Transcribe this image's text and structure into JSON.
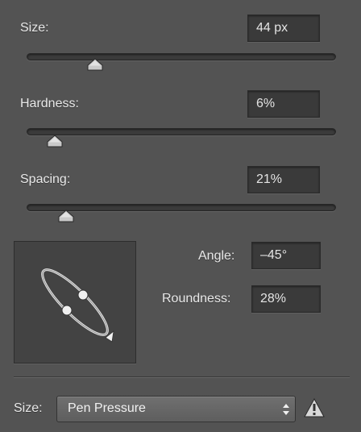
{
  "size": {
    "label": "Size:",
    "value": "44 px",
    "level": 0.2
  },
  "hardness": {
    "label": "Hardness:",
    "value": "6%",
    "level": 0.06
  },
  "spacing": {
    "label": "Spacing:",
    "value": "21%",
    "level": 0.098
  },
  "brush_tip": {
    "angle_label": "Angle:",
    "angle_value": "–45°",
    "roundness_label": "Roundness:",
    "roundness_value": "28%"
  },
  "control": {
    "label": "Size:",
    "selected": "Pen Pressure",
    "icon": "warning-icon"
  },
  "colors": {
    "panel": "#535353",
    "field": "#3a3a3a",
    "text": "#e8e8e8"
  }
}
